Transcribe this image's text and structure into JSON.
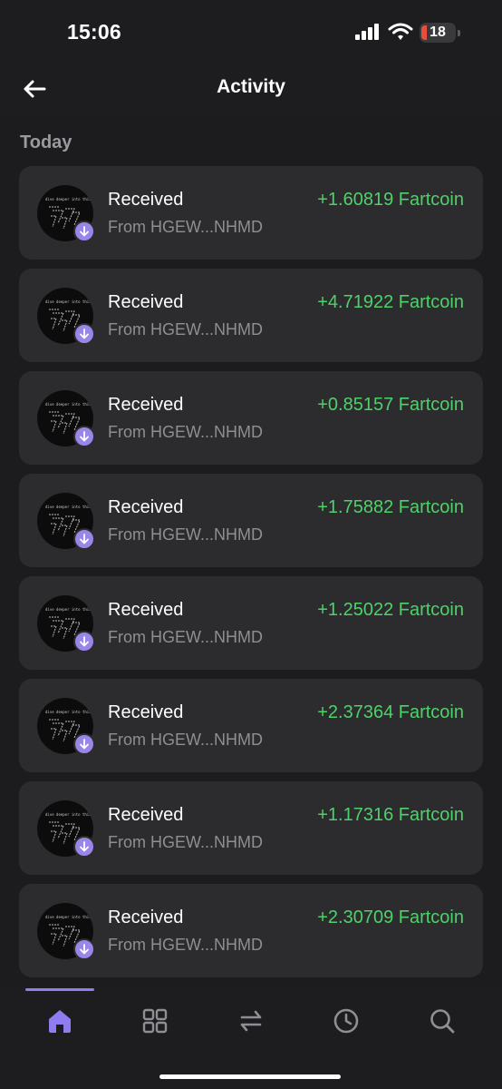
{
  "status": {
    "time": "15:06",
    "battery": "18"
  },
  "header": {
    "title": "Activity"
  },
  "section": {
    "label": "Today"
  },
  "avatar_caption": "dive deeper into this",
  "transactions": [
    {
      "title": "Received",
      "from": "From HGEW...NHMD",
      "amount": "+1.60819 Fartcoin"
    },
    {
      "title": "Received",
      "from": "From HGEW...NHMD",
      "amount": "+4.71922 Fartcoin"
    },
    {
      "title": "Received",
      "from": "From HGEW...NHMD",
      "amount": "+0.85157 Fartcoin"
    },
    {
      "title": "Received",
      "from": "From HGEW...NHMD",
      "amount": "+1.75882 Fartcoin"
    },
    {
      "title": "Received",
      "from": "From HGEW...NHMD",
      "amount": "+1.25022 Fartcoin"
    },
    {
      "title": "Received",
      "from": "From HGEW...NHMD",
      "amount": "+2.37364 Fartcoin"
    },
    {
      "title": "Received",
      "from": "From HGEW...NHMD",
      "amount": "+1.17316 Fartcoin"
    },
    {
      "title": "Received",
      "from": "From HGEW...NHMD",
      "amount": "+2.30709 Fartcoin"
    }
  ],
  "tabs": [
    {
      "icon": "home-icon",
      "active": true
    },
    {
      "icon": "grid-icon",
      "active": false
    },
    {
      "icon": "swap-icon",
      "active": false
    },
    {
      "icon": "clock-icon",
      "active": false
    },
    {
      "icon": "search-icon",
      "active": false
    }
  ],
  "colors": {
    "background": "#1c1c1e",
    "card": "#2c2c2f",
    "accent": "#9a86e8",
    "positive": "#4fd16a",
    "secondary_text": "#8e8e93"
  }
}
